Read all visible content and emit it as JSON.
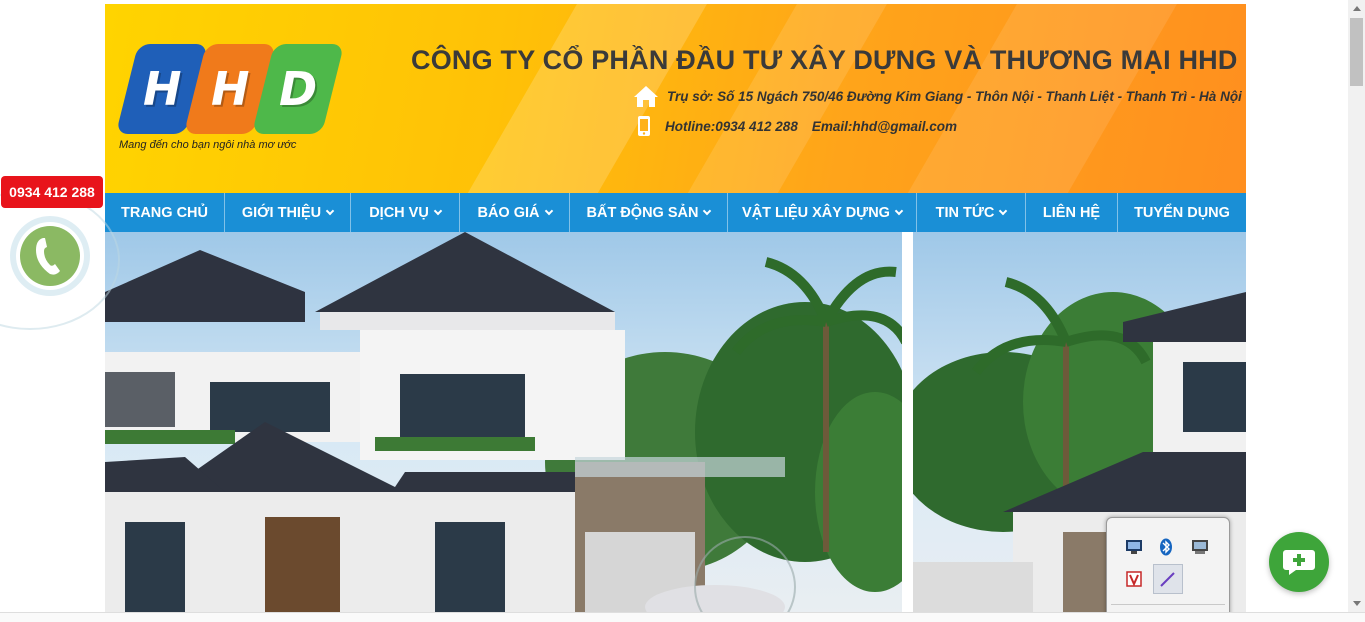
{
  "header": {
    "logo_letters": [
      "H",
      "H",
      "D"
    ],
    "logo_colors": [
      "#1f5fb8",
      "#f07a1b",
      "#4eb84a"
    ],
    "tagline": "Mang đến cho bạn ngôi nhà mơ ước",
    "company_name": "CÔNG TY CỔ PHẦN ĐẦU TƯ XÂY DỰNG VÀ THƯƠNG MẠI HHD",
    "address": "Trụ sở: Số 15 Ngách 750/46 Đường Kim Giang - Thôn Nội - Thanh Liệt - Thanh Trì - Hà Nội",
    "hotline": "Hotline:0934 412 288",
    "email": "Email:hhd@gmail.com"
  },
  "nav": {
    "items": [
      {
        "label": "TRANG CHỦ",
        "has_dropdown": false
      },
      {
        "label": "GIỚI THIỆU",
        "has_dropdown": true
      },
      {
        "label": "DỊCH VỤ",
        "has_dropdown": true
      },
      {
        "label": "BÁO GIÁ",
        "has_dropdown": true
      },
      {
        "label": "BẤT ĐỘNG SẢN",
        "has_dropdown": true
      },
      {
        "label": "VẬT LIỆU XÂY DỰNG",
        "has_dropdown": true
      },
      {
        "label": "TIN TỨC",
        "has_dropdown": true
      },
      {
        "label": "LIÊN HỆ",
        "has_dropdown": false
      },
      {
        "label": "TUYỂN DỤNG",
        "has_dropdown": false
      }
    ]
  },
  "side": {
    "phone_number": "0934 412 288"
  },
  "icons": {
    "home": "home-icon",
    "mobile": "mobile-icon",
    "call": "phone-icon",
    "chat": "chat-plus-icon"
  },
  "colors": {
    "nav_bg": "#1a8fd6",
    "phone_badge": "#e8141b",
    "chat_fab": "#3ea53a",
    "call_btn": "#8bb963"
  }
}
